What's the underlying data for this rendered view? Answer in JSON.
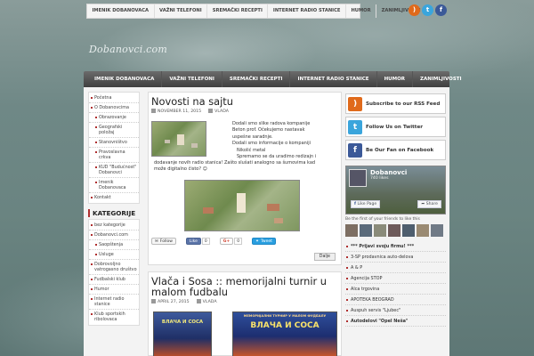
{
  "top_nav": [
    "IMENIK DOBANOVACA",
    "VAŽNI TELEFONI",
    "SREMAČKI RECEPTI",
    "INTERNET RADIO STANICE",
    "HUMOR",
    "ZANIMLJIVOSTI"
  ],
  "social_icons": [
    {
      "name": "rss-icon",
      "color": "#e06a1b"
    },
    {
      "name": "twitter-icon",
      "color": "#3aa5dc"
    },
    {
      "name": "facebook-icon",
      "color": "#3b5998"
    }
  ],
  "logo": "Dobanovci.com",
  "main_nav": [
    "IMENIK DOBANOVACA",
    "VAŽNI TELEFONI",
    "SREMAČKI RECEPTI",
    "INTERNET RADIO STANICE",
    "HUMOR",
    "ZANIMLJIVOSTI"
  ],
  "left_menu": [
    {
      "label": "Početna",
      "sub": false
    },
    {
      "label": "O Dobanovcima",
      "sub": false
    },
    {
      "label": "Obrazovanje",
      "sub": true
    },
    {
      "label": "Geografski položaj",
      "sub": true
    },
    {
      "label": "Stanovništvo",
      "sub": true
    },
    {
      "label": "Pravoslavna crkva",
      "sub": true
    },
    {
      "label": "KUD \"Budućnost\" Dobanovci",
      "sub": true
    },
    {
      "label": "Imenik Dobanovaca",
      "sub": true
    },
    {
      "label": "Kontakt",
      "sub": false
    }
  ],
  "categories_title": "KATEGORIJE",
  "categories": [
    {
      "label": "bez kategorije",
      "sub": false
    },
    {
      "label": "Dobanovci.com",
      "sub": false
    },
    {
      "label": "Saopštenja",
      "sub": true
    },
    {
      "label": "Usluge",
      "sub": true
    },
    {
      "label": "Dobrovoljno vatrogasno društvo",
      "sub": false
    },
    {
      "label": "Fudbalski klub",
      "sub": false
    },
    {
      "label": "Humor",
      "sub": false
    },
    {
      "label": "Internet radio stanice",
      "sub": false
    },
    {
      "label": "Klub sportskih ribolovaca",
      "sub": false
    }
  ],
  "post1": {
    "title": "Novosti na sajtu",
    "date": "NOVEMBER 11, 2015",
    "author": "VLADA",
    "text_lines": [
      "Dodali smo slike radova kompanije",
      "Beton prof. Očekujemo nastavak",
      "uspešne saradnje.",
      "Dodali smo informacije o kompaniji",
      "Nikolić metal",
      "Spremamo se da uradimo redizajn i"
    ],
    "text_full": [
      "dodavanje novih radio stanica! Zašto slušati analogno sa šumovima kad",
      "može digitalno čisto? ☺"
    ],
    "follow": "Follow",
    "like": "Like",
    "like_count": "0",
    "gplus": "G+",
    "gplus_count": "0",
    "tweet": "Tweet",
    "more": "Dalje"
  },
  "post2": {
    "title": "Vlača i Sosa :: memorijalni turnir u malom fudbalu",
    "date": "APRIL 27, 2015",
    "author": "VLADA",
    "poster1": "ВЛАЧА И СОСА",
    "poster2": "ВЛАЧА И СОСА",
    "poster2_header": "МЕМОРИЈАЛНИ ТУРНИР У МАЛОМ ФУДБАЛУ"
  },
  "right_boxes": [
    {
      "label": "Subscribe to our RSS Feed",
      "icon": "rss-icon",
      "color": "#e06a1b",
      "glyph": ")"
    },
    {
      "label": "Follow Us on Twitter",
      "icon": "twitter-icon",
      "color": "#3aa5dc",
      "glyph": "t"
    },
    {
      "label": "Be Our Fan on Facebook",
      "icon": "facebook-icon",
      "color": "#3b5998",
      "glyph": "f"
    }
  ],
  "fb_widget": {
    "name": "Dobanovci",
    "likes": "740 likes",
    "like_page": "Like Page",
    "share": "Share",
    "friends_text": "Be the first of your friends to like this"
  },
  "right_list": [
    {
      "label": "*** Prijavi svoju firmu! ***",
      "bold": true
    },
    {
      "label": "3-SP prodavnica auto-delova",
      "bold": false
    },
    {
      "label": "A & P",
      "bold": false
    },
    {
      "label": "Agencija STOP",
      "bold": false
    },
    {
      "label": "Alca trgovina",
      "bold": false
    },
    {
      "label": "APOTEKA BEOGRAD",
      "bold": false
    },
    {
      "label": "Auspuh servis \"Ljubec\"",
      "bold": false
    },
    {
      "label": "Autodelovi \"Opel Neša\"",
      "bold": true
    }
  ]
}
